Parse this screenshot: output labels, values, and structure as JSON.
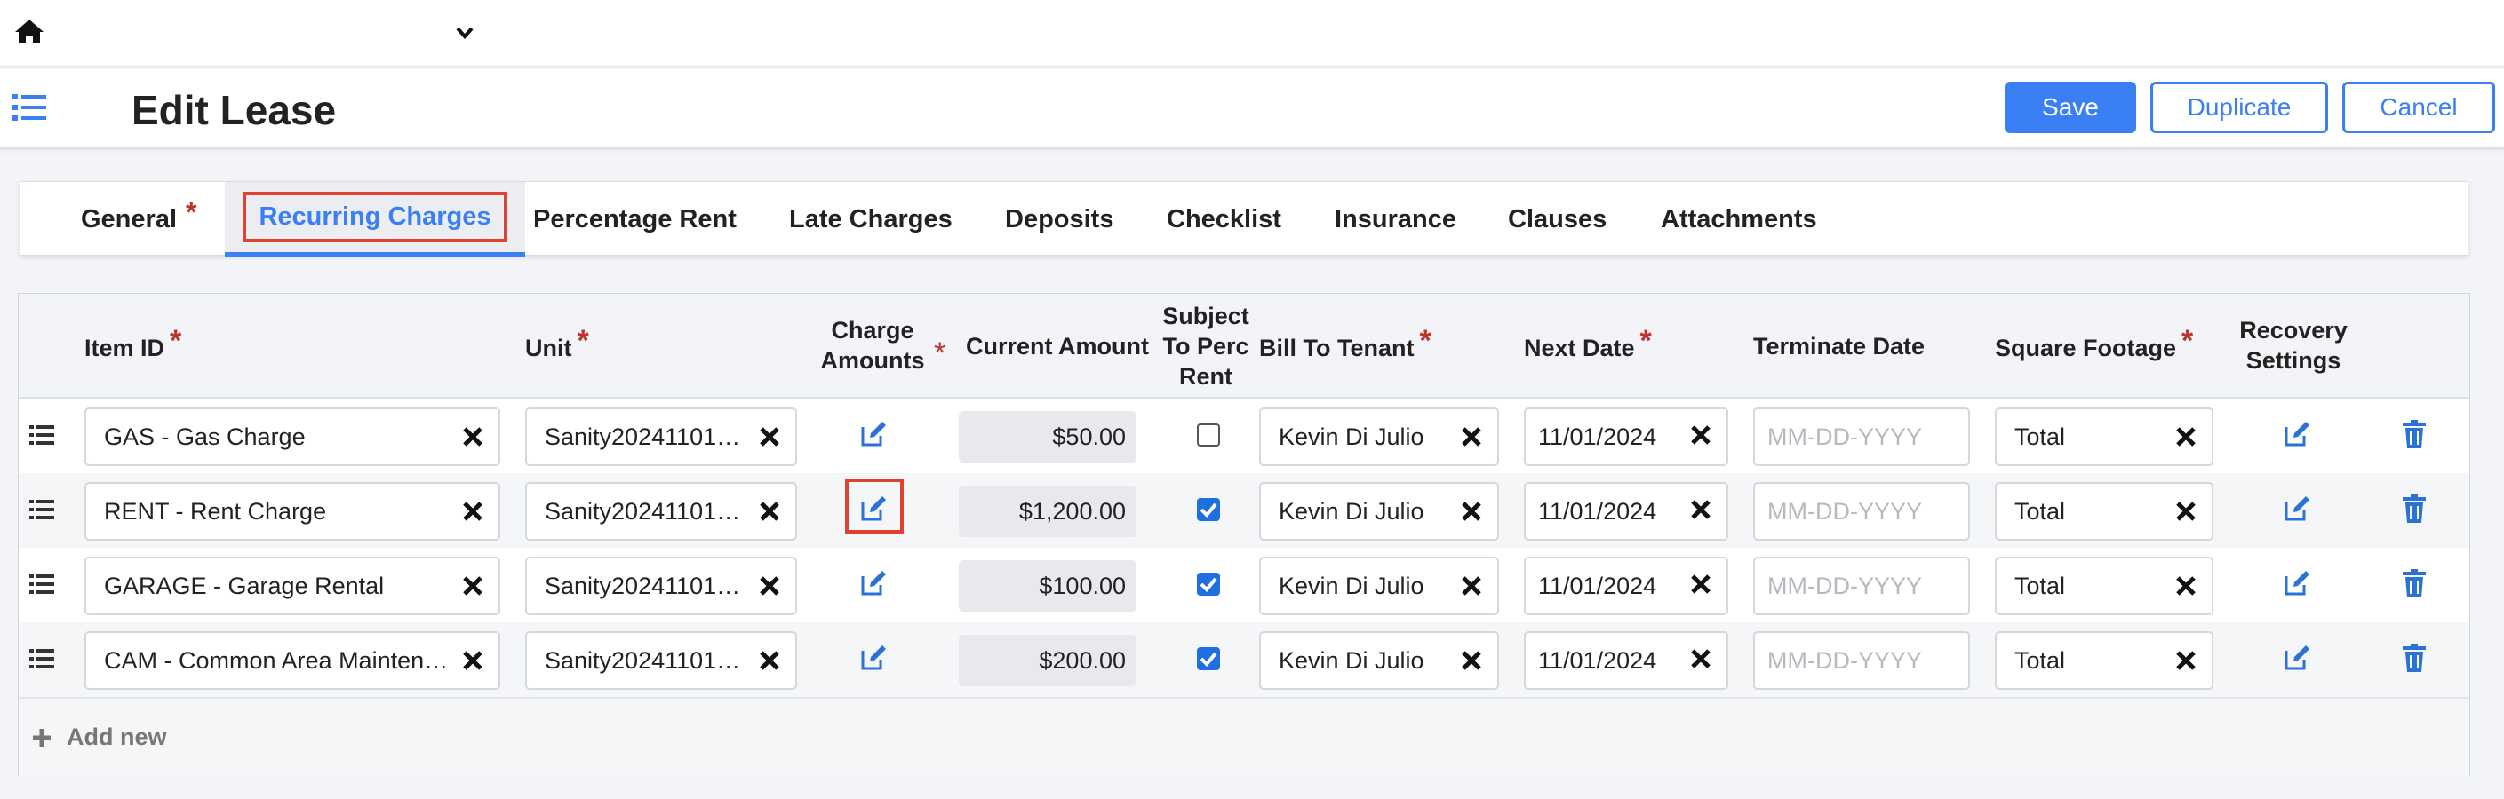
{
  "header": {
    "title": "Edit Lease",
    "save_label": "Save",
    "duplicate_label": "Duplicate",
    "cancel_label": "Cancel"
  },
  "tabs": [
    {
      "label": "General",
      "required": true
    },
    {
      "label": "Recurring Charges",
      "active": true
    },
    {
      "label": "Percentage Rent"
    },
    {
      "label": "Late Charges"
    },
    {
      "label": "Deposits"
    },
    {
      "label": "Checklist"
    },
    {
      "label": "Insurance"
    },
    {
      "label": "Clauses"
    },
    {
      "label": "Attachments"
    }
  ],
  "table": {
    "columns": {
      "item_id": "Item ID",
      "unit": "Unit",
      "charge_amounts": [
        "Charge",
        "Amounts"
      ],
      "current_amount": "Current Amount",
      "subject_to_perc_rent": [
        "Subject",
        "To Perc",
        "Rent"
      ],
      "bill_to_tenant": "Bill To Tenant",
      "next_date": "Next Date",
      "terminate_date": "Terminate Date",
      "square_footage": "Square Footage",
      "recovery_settings": [
        "Recovery",
        "Settings"
      ]
    },
    "rows": [
      {
        "item_id": "GAS - Gas Charge",
        "unit": "Sanity20241101…",
        "current_amount": "$50.00",
        "subject": false,
        "tenant": "Kevin Di Julio",
        "next_date": "11/01/2024",
        "terminate_placeholder": "MM-DD-YYYY",
        "sqft": "Total"
      },
      {
        "item_id": "RENT - Rent Charge",
        "unit": "Sanity20241101…",
        "current_amount": "$1,200.00",
        "subject": true,
        "tenant": "Kevin Di Julio",
        "next_date": "11/01/2024",
        "terminate_placeholder": "MM-DD-YYYY",
        "sqft": "Total"
      },
      {
        "item_id": "GARAGE - Garage Rental",
        "unit": "Sanity20241101…",
        "current_amount": "$100.00",
        "subject": true,
        "tenant": "Kevin Di Julio",
        "next_date": "11/01/2024",
        "terminate_placeholder": "MM-DD-YYYY",
        "sqft": "Total"
      },
      {
        "item_id": "CAM - Common Area Mainten…",
        "unit": "Sanity20241101…",
        "current_amount": "$200.00",
        "subject": true,
        "tenant": "Kevin Di Julio",
        "next_date": "11/01/2024",
        "terminate_placeholder": "MM-DD-YYYY",
        "sqft": "Total"
      }
    ],
    "add_new_label": "Add new"
  },
  "colors": {
    "accent": "#3b7ff5",
    "required": "#c0322b",
    "highlight": "#e04030",
    "checkbox": "#1f6fe0"
  },
  "icons": {
    "home": "home-icon",
    "dropdown": "chevron-down-icon",
    "menu": "list-menu-icon",
    "drag": "drag-handle-icon",
    "clear": "close-icon",
    "edit": "edit-icon",
    "delete": "trash-icon",
    "add": "plus-icon"
  }
}
